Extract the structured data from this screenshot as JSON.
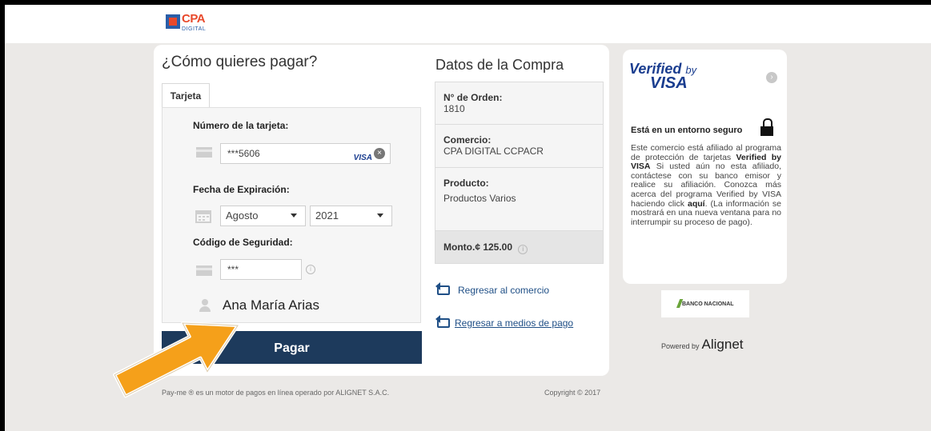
{
  "header": {
    "logo_text": "CPA",
    "logo_sub": "DIGITAL"
  },
  "payment": {
    "heading": "¿Cómo quieres pagar?",
    "tab_label": "Tarjeta",
    "card_number_label": "Número de la tarjeta:",
    "card_number_value": "***5606",
    "card_brand": "VISA",
    "expiry_label": "Fecha de Expiración:",
    "expiry_month": "Agosto",
    "expiry_year": "2021",
    "cvv_label": "Código de Seguridad:",
    "cvv_value": "***",
    "holder_name": "Ana María Arias",
    "pay_button": "Pagar"
  },
  "purchase": {
    "heading": "Datos de la Compra",
    "order_label": "N° de Orden:",
    "order_value": "1810",
    "merchant_label": "Comercio:",
    "merchant_value": "CPA DIGITAL CCPACR",
    "product_label": "Producto:",
    "product_value": "Productos Varios",
    "amount_label": "Monto.¢ 125.00",
    "link_back_merchant": "Regresar al comercio",
    "link_back_methods": "Regresar a medios de pago"
  },
  "footer": {
    "left": "Pay-me ® es un motor de pagos en línea operado por ALIGNET S.A.C.",
    "right": "Copyright © 2017"
  },
  "verified": {
    "title_1": "Verified",
    "title_by": "by",
    "title_2": "VISA",
    "secure_heading": "Está en un entorno seguro",
    "text_1": "Este comercio está afiliado al programa de protección de tarjetas ",
    "text_bold": "Verified by VISA",
    "text_2": " Si usted aún no esta afiliado, contáctese con su banco emisor y realice su afiliación. Conozca más acerca del programa Verified by VISA haciendo click ",
    "text_link": "aquí",
    "text_3": ". (La información se mostrará en una nueva ventana para no interrumpir su proceso de pago).",
    "bank_logo": "BANCO NACIONAL",
    "powered_by": "Powered by",
    "powered_brand": "Alignet"
  },
  "colors": {
    "primary": "#1d3a5c",
    "visa_blue": "#1a3d8f",
    "arrow": "#f5a01a"
  }
}
